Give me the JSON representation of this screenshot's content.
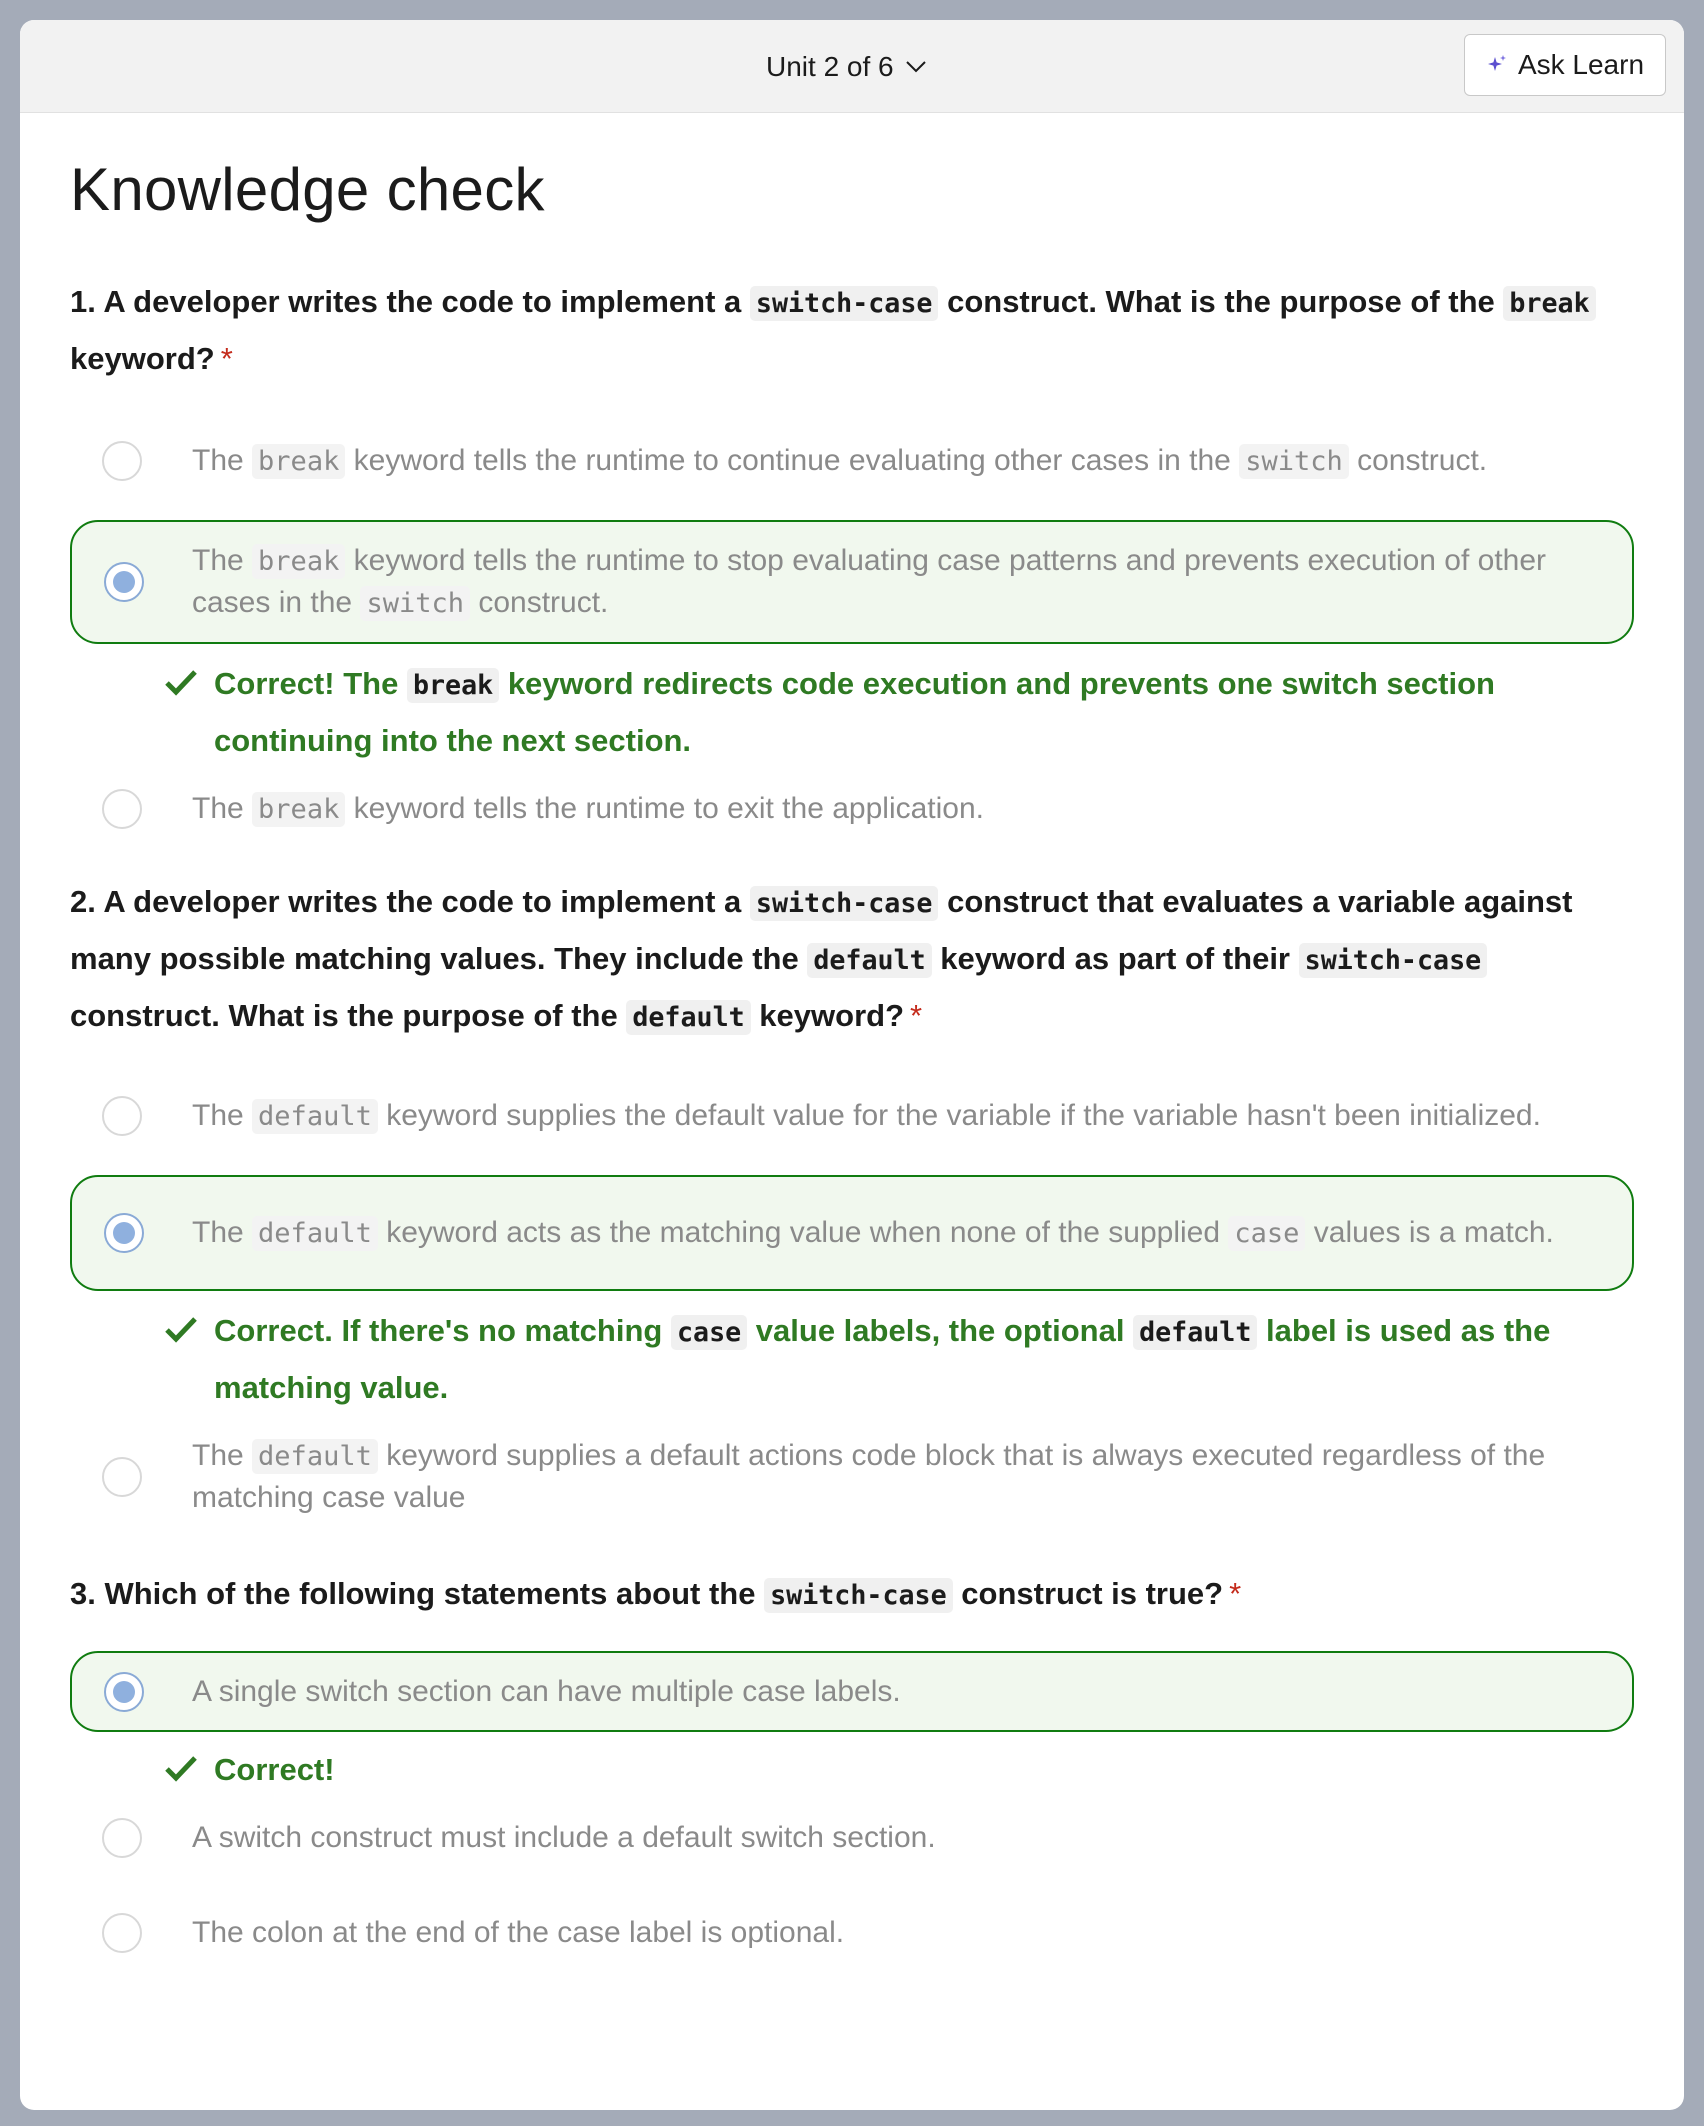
{
  "topbar": {
    "unit_label": "Unit 2 of 6",
    "ask_learn_label": "Ask Learn"
  },
  "page_title": "Knowledge check",
  "colors": {
    "correct_green": "#2f7a23",
    "selected_border": "#107c10",
    "selected_bg": "#f1f8ee",
    "required_red": "#c42b1c"
  },
  "questions": [
    {
      "number": "1.",
      "text_parts": [
        "A developer writes the code to implement a",
        "switch-case",
        "construct. What is the purpose of the",
        "break",
        "keyword?"
      ],
      "required": "*",
      "options": [
        {
          "parts": [
            "The",
            "break",
            "keyword tells the runtime to continue evaluating other cases in the",
            "switch",
            "construct."
          ],
          "selected": false
        },
        {
          "parts": [
            "The",
            "break",
            "keyword tells the runtime to stop evaluating case patterns and prevents execution of other cases in the",
            "switch",
            "construct."
          ],
          "selected": true,
          "feedback_parts": [
            "Correct! The",
            "break",
            "keyword redirects code execution and prevents one switch section continuing into the next section."
          ]
        },
        {
          "parts": [
            "The",
            "break",
            "keyword tells the runtime to exit the application."
          ],
          "selected": false
        }
      ]
    },
    {
      "number": "2.",
      "text_parts": [
        "A developer writes the code to implement a",
        "switch-case",
        "construct that evaluates a variable against many possible matching values. They include the",
        "default",
        "keyword as part of their",
        "switch-case",
        "construct. What is the purpose of the",
        "default",
        "keyword?"
      ],
      "required": "*",
      "options": [
        {
          "parts": [
            "The",
            "default",
            "keyword supplies the default value for the variable if the variable hasn't been initialized."
          ],
          "selected": false
        },
        {
          "parts": [
            "The",
            "default",
            "keyword acts as the matching value when none of the supplied",
            "case",
            "values is a match."
          ],
          "selected": true,
          "feedback_parts": [
            "Correct. If there's no matching",
            "case",
            "value labels, the optional",
            "default",
            "label is used as the matching value."
          ]
        },
        {
          "parts": [
            "The",
            "default",
            "keyword supplies a default actions code block that is always executed regardless of the matching case value"
          ],
          "selected": false
        }
      ]
    },
    {
      "number": "3.",
      "text_parts": [
        "Which of the following statements about the",
        "switch-case",
        "construct is true?"
      ],
      "required": "*",
      "options": [
        {
          "text": "A single switch section can have multiple case labels.",
          "selected": true,
          "feedback": "Correct!"
        },
        {
          "text": "A switch construct must include a default switch section.",
          "selected": false
        },
        {
          "text": "The colon at the end of the case label is optional.",
          "selected": false
        }
      ]
    }
  ]
}
